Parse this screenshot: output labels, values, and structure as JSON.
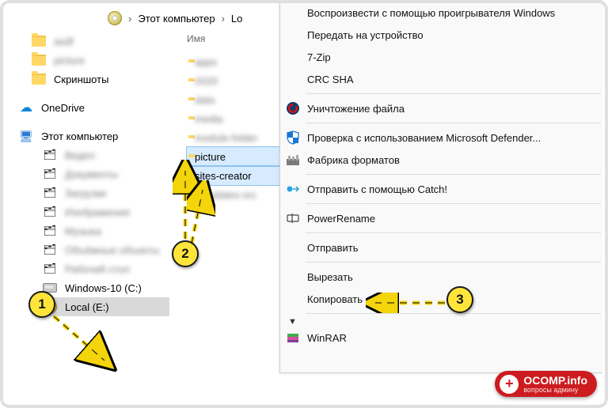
{
  "breadcrumb": {
    "location": "Этот компьютер",
    "drive_prefix": "Lo"
  },
  "sidebar": {
    "quick_items": [
      {
        "name": "asdf",
        "blur": true
      },
      {
        "name": "picture",
        "blur": true
      },
      {
        "name": "Скриншоты",
        "blur": false
      }
    ],
    "onedrive": "OneDrive",
    "this_pc": "Этот компьютер",
    "pc_items": [
      {
        "name": "Видео",
        "blur": true
      },
      {
        "name": "Документы",
        "blur": true
      },
      {
        "name": "Загрузки",
        "blur": true
      },
      {
        "name": "Изображения",
        "blur": true
      },
      {
        "name": "Музыка",
        "blur": true
      },
      {
        "name": "Объёмные объекты",
        "blur": true
      },
      {
        "name": "Рабочий стол",
        "blur": true
      }
    ],
    "windows_drive": "Windows-10 (C:)",
    "local_drive": "Local (E:)"
  },
  "column_header": "Имя",
  "files": [
    {
      "name": "apps",
      "blur": true,
      "selected": false
    },
    {
      "name": "2020",
      "blur": true,
      "selected": false
    },
    {
      "name": "data",
      "blur": true,
      "selected": false
    },
    {
      "name": "media",
      "blur": true,
      "selected": false
    },
    {
      "name": "module-folder",
      "blur": true,
      "selected": false
    },
    {
      "name": "picture",
      "blur": false,
      "selected": true
    },
    {
      "name": "sites-creator",
      "blur": false,
      "selected": true
    },
    {
      "name": "templates-src",
      "blur": true,
      "selected": false
    }
  ],
  "context_menu": {
    "items": [
      {
        "label": "Воспроизвести с помощью проигрывателя Windows",
        "icon": "",
        "sep_after": false
      },
      {
        "label": "Передать на устройство",
        "icon": "",
        "submenu": true,
        "sep_after": false
      },
      {
        "label": "7-Zip",
        "icon": "",
        "submenu": true,
        "sep_after": false
      },
      {
        "label": "CRC SHA",
        "icon": "",
        "submenu": true,
        "sep_after": true
      },
      {
        "label": "Уничтожение файла",
        "icon": "ccleaner",
        "sep_after": true
      },
      {
        "label": "Проверка с использованием Microsoft Defender...",
        "icon": "defender",
        "sep_after": false
      },
      {
        "label": "Фабрика форматов",
        "icon": "factory",
        "submenu": true,
        "sep_after": true
      },
      {
        "label": "Отправить с помощью Catch!",
        "icon": "catch",
        "sep_after": true
      },
      {
        "label": "PowerRename",
        "icon": "rename",
        "sep_after": true
      },
      {
        "label": "Отправить",
        "icon": "",
        "submenu": true,
        "sep_after": true
      },
      {
        "label": "Вырезать",
        "icon": "",
        "sep_after": false
      },
      {
        "label": "Копировать",
        "icon": "",
        "sep_after": true
      },
      {
        "label": "WinRAR",
        "icon": "winrar",
        "submenu": true,
        "expand_above": true,
        "sep_after": false
      }
    ]
  },
  "markers": {
    "m1": "1",
    "m2": "2",
    "m3": "3"
  },
  "watermark": {
    "title": "OCOMP.info",
    "sub": "вопросы админу"
  }
}
